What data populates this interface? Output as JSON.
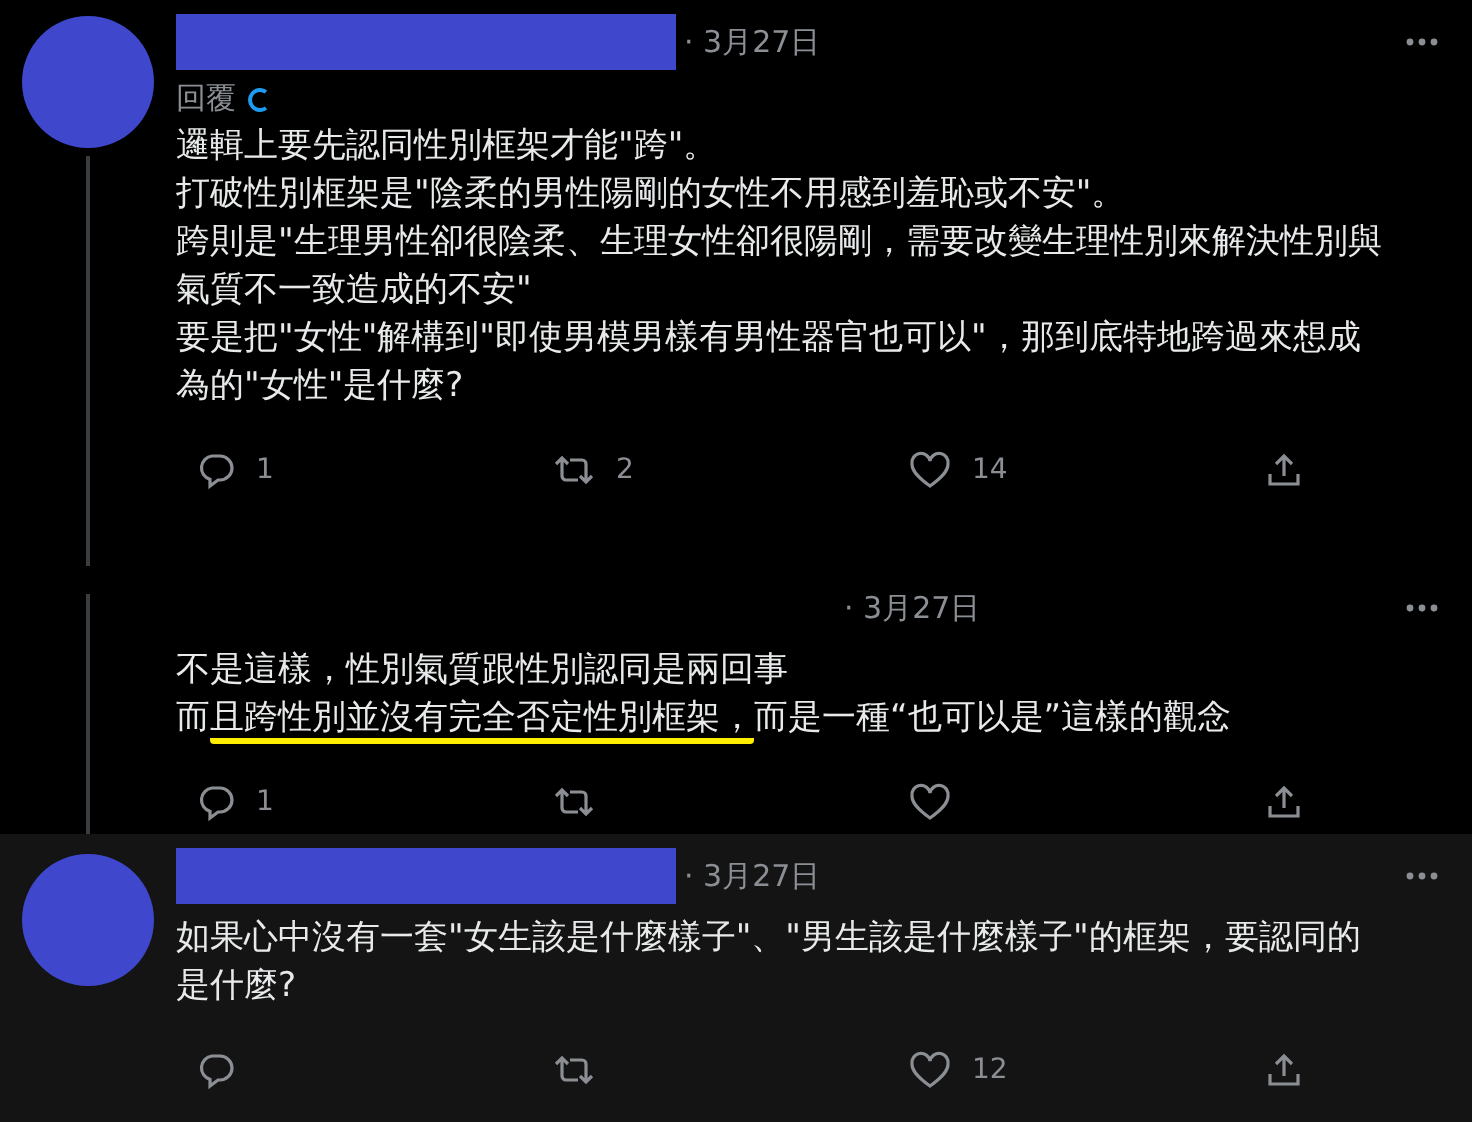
{
  "tweets": [
    {
      "avatar": true,
      "name_redacted": true,
      "date": "· 3月27日",
      "reply_to": "回覆",
      "thread_below": true,
      "highlighted": false,
      "paragraphs": [
        [
          {
            "text": "邏輯上要先認同性別框架才能\"跨\"。",
            "underlined": false
          }
        ],
        [
          {
            "text": "打破性別框架是\"陰柔的男性陽剛的女性不用感到羞恥或不安\"。",
            "underlined": false
          }
        ],
        [
          {
            "text": "跨則是\"生理男性卻很陰柔、生理女性卻很陽剛，需要改變生理性別來解決性別與氣質不一致造成的不安\"",
            "underlined": false
          }
        ],
        [
          {
            "text": "要是把\"女性\"解構到\"即使男模男樣有男性器官也可以\"，那到底特地跨過來想成為的\"女性\"是什麼?",
            "underlined": false
          }
        ]
      ],
      "counts": {
        "reply": "1",
        "retweet": "2",
        "like": "14"
      }
    },
    {
      "avatar": false,
      "name_redacted": false,
      "date": "· 3月27日",
      "thread_below": true,
      "highlighted": false,
      "paragraphs": [
        [
          {
            "text": "不是這樣，性別氣質跟性別認同是兩回事",
            "underlined": false
          }
        ],
        [
          {
            "text": "而",
            "underlined": false
          },
          {
            "text": "且跨性別並沒有完全否定性別框架，",
            "underlined": true
          },
          {
            "text": "而是一種“也可以是”這樣的觀念",
            "underlined": false
          }
        ]
      ],
      "counts": {
        "reply": "1"
      }
    },
    {
      "avatar": true,
      "name_redacted": true,
      "date": "· 3月27日",
      "thread_below": false,
      "highlighted": true,
      "paragraphs": [
        [
          {
            "text": "如果心中沒有一套\"女生該是什麼樣子\"、\"男生該是什麼樣子\"的框架，要認同的是什麼?",
            "underlined": false
          }
        ]
      ],
      "counts": {
        "like": "12"
      }
    }
  ]
}
